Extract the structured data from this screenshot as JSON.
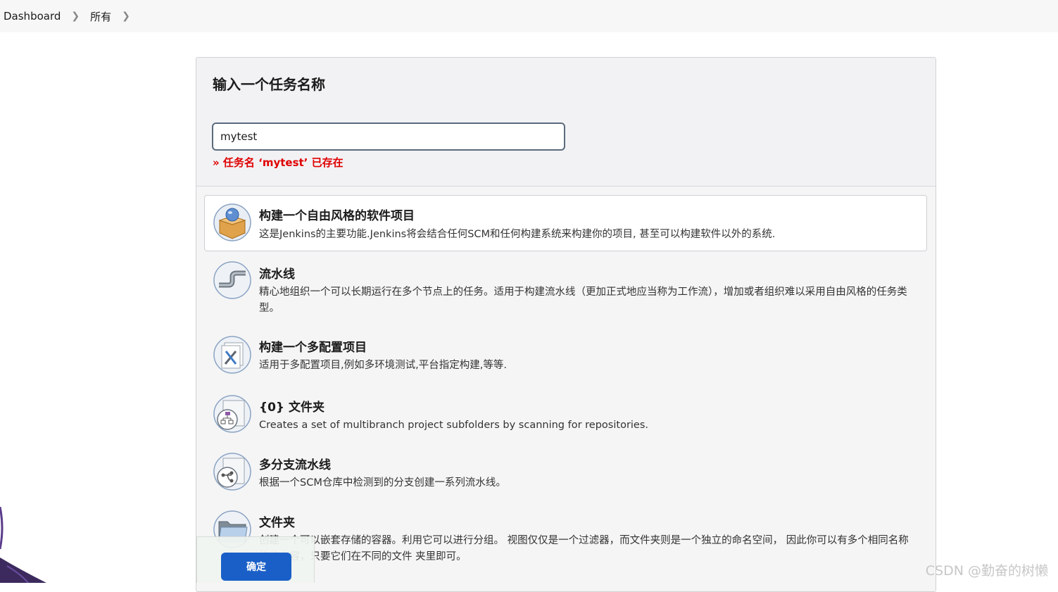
{
  "breadcrumb": {
    "items": [
      "Dashboard",
      "所有"
    ],
    "separator": ">"
  },
  "new_item": {
    "heading": "输入一个任务名称",
    "input_value": "mytest",
    "error": "» 任务名 ‘mytest’ 已存在"
  },
  "item_types": [
    {
      "title": "构建一个自由风格的软件项目",
      "description": "这是Jenkins的主要功能.Jenkins将会结合任何SCM和任何构建系统来构建你的项目, 甚至可以构建软件以外的系统.",
      "icon": "freestyle-project-icon",
      "selected": true
    },
    {
      "title": "流水线",
      "description": "精心地组织一个可以长期运行在多个节点上的任务。适用于构建流水线（更加正式地应当称为工作流），增加或者组织难以采用自由风格的任务类型。",
      "icon": "pipeline-icon",
      "selected": false
    },
    {
      "title": "构建一个多配置项目",
      "description": "适用于多配置项目,例如多环境测试,平台指定构建,等等.",
      "icon": "multi-configuration-icon",
      "selected": false
    },
    {
      "title": "{0} 文件夹",
      "description": "Creates a set of multibranch project subfolders by scanning for repositories.",
      "icon": "organization-folder-icon",
      "selected": false
    },
    {
      "title": "多分支流水线",
      "description": "根据一个SCM仓库中检测到的分支创建一系列流水线。",
      "icon": "multibranch-pipeline-icon",
      "selected": false
    },
    {
      "title": "文件夹",
      "description": "创建一个可以嵌套存储的容器。利用它可以进行分组。 视图仅仅是一个过滤器，而文件夹则是一个独立的命名空间， 因此你可以有多个相同名称的的内容，只要它们在不同的文件 夹里即可。",
      "icon": "folder-icon",
      "selected": false
    }
  ],
  "actions": {
    "ok_label": "确定"
  },
  "watermark": "CSDN @勤奋的树懒",
  "colors": {
    "primary_button": "#1a5fc7",
    "error": "#e00000",
    "input_border": "#5b6b7c"
  }
}
